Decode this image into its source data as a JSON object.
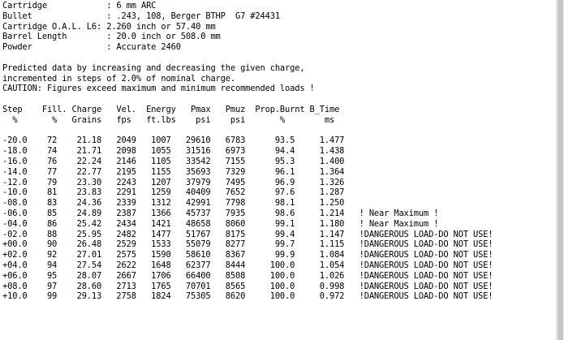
{
  "header": [
    "Cartridge            : 6 mm ARC",
    "Bullet               : .243, 108, Berger BTHP  G7 #24431",
    "Cartridge O.A.L. L6: 2.260 inch or 57.40 mm",
    "Barrel Length        : 20.0 inch or 508.0 mm",
    "Powder               : Accurate 2460"
  ],
  "intro": [
    "Predicted data by increasing and decreasing the given charge,",
    "incremented in steps of 2.0% of nominal charge.",
    "CAUTION: Figures exceed maximum and minimum recommended loads !"
  ],
  "columns": {
    "line1": "Step    Fill. Charge   Vel.  Energy   Pmax   Pmuz  Prop.Burnt B_Time",
    "line2": "  %       %   Grains   fps   ft.lbs    psi    psi       %        ms"
  },
  "rows": [
    {
      "step": "-20.0",
      "fill": "72",
      "charge": "21.18",
      "vel": "2049",
      "energy": "1007",
      "pmax": "29610",
      "pmuz": "6783",
      "burnt": "93.5",
      "btime": "1.477",
      "note": ""
    },
    {
      "step": "-18.0",
      "fill": "74",
      "charge": "21.71",
      "vel": "2098",
      "energy": "1055",
      "pmax": "31516",
      "pmuz": "6973",
      "burnt": "94.4",
      "btime": "1.438",
      "note": ""
    },
    {
      "step": "-16.0",
      "fill": "76",
      "charge": "22.24",
      "vel": "2146",
      "energy": "1105",
      "pmax": "33542",
      "pmuz": "7155",
      "burnt": "95.3",
      "btime": "1.400",
      "note": ""
    },
    {
      "step": "-14.0",
      "fill": "77",
      "charge": "22.77",
      "vel": "2195",
      "energy": "1155",
      "pmax": "35693",
      "pmuz": "7329",
      "burnt": "96.1",
      "btime": "1.364",
      "note": ""
    },
    {
      "step": "-12.0",
      "fill": "79",
      "charge": "23.30",
      "vel": "2243",
      "energy": "1207",
      "pmax": "37979",
      "pmuz": "7495",
      "burnt": "96.9",
      "btime": "1.326",
      "note": ""
    },
    {
      "step": "-10.0",
      "fill": "81",
      "charge": "23.83",
      "vel": "2291",
      "energy": "1259",
      "pmax": "40409",
      "pmuz": "7652",
      "burnt": "97.6",
      "btime": "1.287",
      "note": ""
    },
    {
      "step": "-08.0",
      "fill": "83",
      "charge": "24.36",
      "vel": "2339",
      "energy": "1312",
      "pmax": "42991",
      "pmuz": "7798",
      "burnt": "98.1",
      "btime": "1.250",
      "note": ""
    },
    {
      "step": "-06.0",
      "fill": "85",
      "charge": "24.89",
      "vel": "2387",
      "energy": "1366",
      "pmax": "45737",
      "pmuz": "7935",
      "burnt": "98.6",
      "btime": "1.214",
      "note": "! Near Maximum !"
    },
    {
      "step": "-04.0",
      "fill": "86",
      "charge": "25.42",
      "vel": "2434",
      "energy": "1421",
      "pmax": "48658",
      "pmuz": "8060",
      "burnt": "99.1",
      "btime": "1.180",
      "note": "! Near Maximum !"
    },
    {
      "step": "-02.0",
      "fill": "88",
      "charge": "25.95",
      "vel": "2482",
      "energy": "1477",
      "pmax": "51767",
      "pmuz": "8175",
      "burnt": "99.4",
      "btime": "1.147",
      "note": "!DANGEROUS LOAD-DO NOT USE!"
    },
    {
      "step": "+00.0",
      "fill": "90",
      "charge": "26.48",
      "vel": "2529",
      "energy": "1533",
      "pmax": "55079",
      "pmuz": "8277",
      "burnt": "99.7",
      "btime": "1.115",
      "note": "!DANGEROUS LOAD-DO NOT USE!"
    },
    {
      "step": "+02.0",
      "fill": "92",
      "charge": "27.01",
      "vel": "2575",
      "energy": "1590",
      "pmax": "58610",
      "pmuz": "8367",
      "burnt": "99.9",
      "btime": "1.084",
      "note": "!DANGEROUS LOAD-DO NOT USE!"
    },
    {
      "step": "+04.0",
      "fill": "94",
      "charge": "27.54",
      "vel": "2622",
      "energy": "1648",
      "pmax": "62377",
      "pmuz": "8444",
      "burnt": "100.0",
      "btime": "1.054",
      "note": "!DANGEROUS LOAD-DO NOT USE!"
    },
    {
      "step": "+06.0",
      "fill": "95",
      "charge": "28.07",
      "vel": "2667",
      "energy": "1706",
      "pmax": "66400",
      "pmuz": "8508",
      "burnt": "100.0",
      "btime": "1.026",
      "note": "!DANGEROUS LOAD-DO NOT USE!"
    },
    {
      "step": "+08.0",
      "fill": "97",
      "charge": "28.60",
      "vel": "2713",
      "energy": "1765",
      "pmax": "70701",
      "pmuz": "8565",
      "burnt": "100.0",
      "btime": "0.998",
      "note": "!DANGEROUS LOAD-DO NOT USE!"
    },
    {
      "step": "+10.0",
      "fill": "99",
      "charge": "29.13",
      "vel": "2758",
      "energy": "1824",
      "pmax": "75305",
      "pmuz": "8620",
      "burnt": "100.0",
      "btime": "0.972",
      "note": "!DANGEROUS LOAD-DO NOT USE!"
    }
  ],
  "colors": {
    "text": "#000000",
    "background": "#ffffff",
    "scrollbar": "#f0f0f0"
  },
  "scroll": {
    "thumb_fraction": 1.0
  }
}
